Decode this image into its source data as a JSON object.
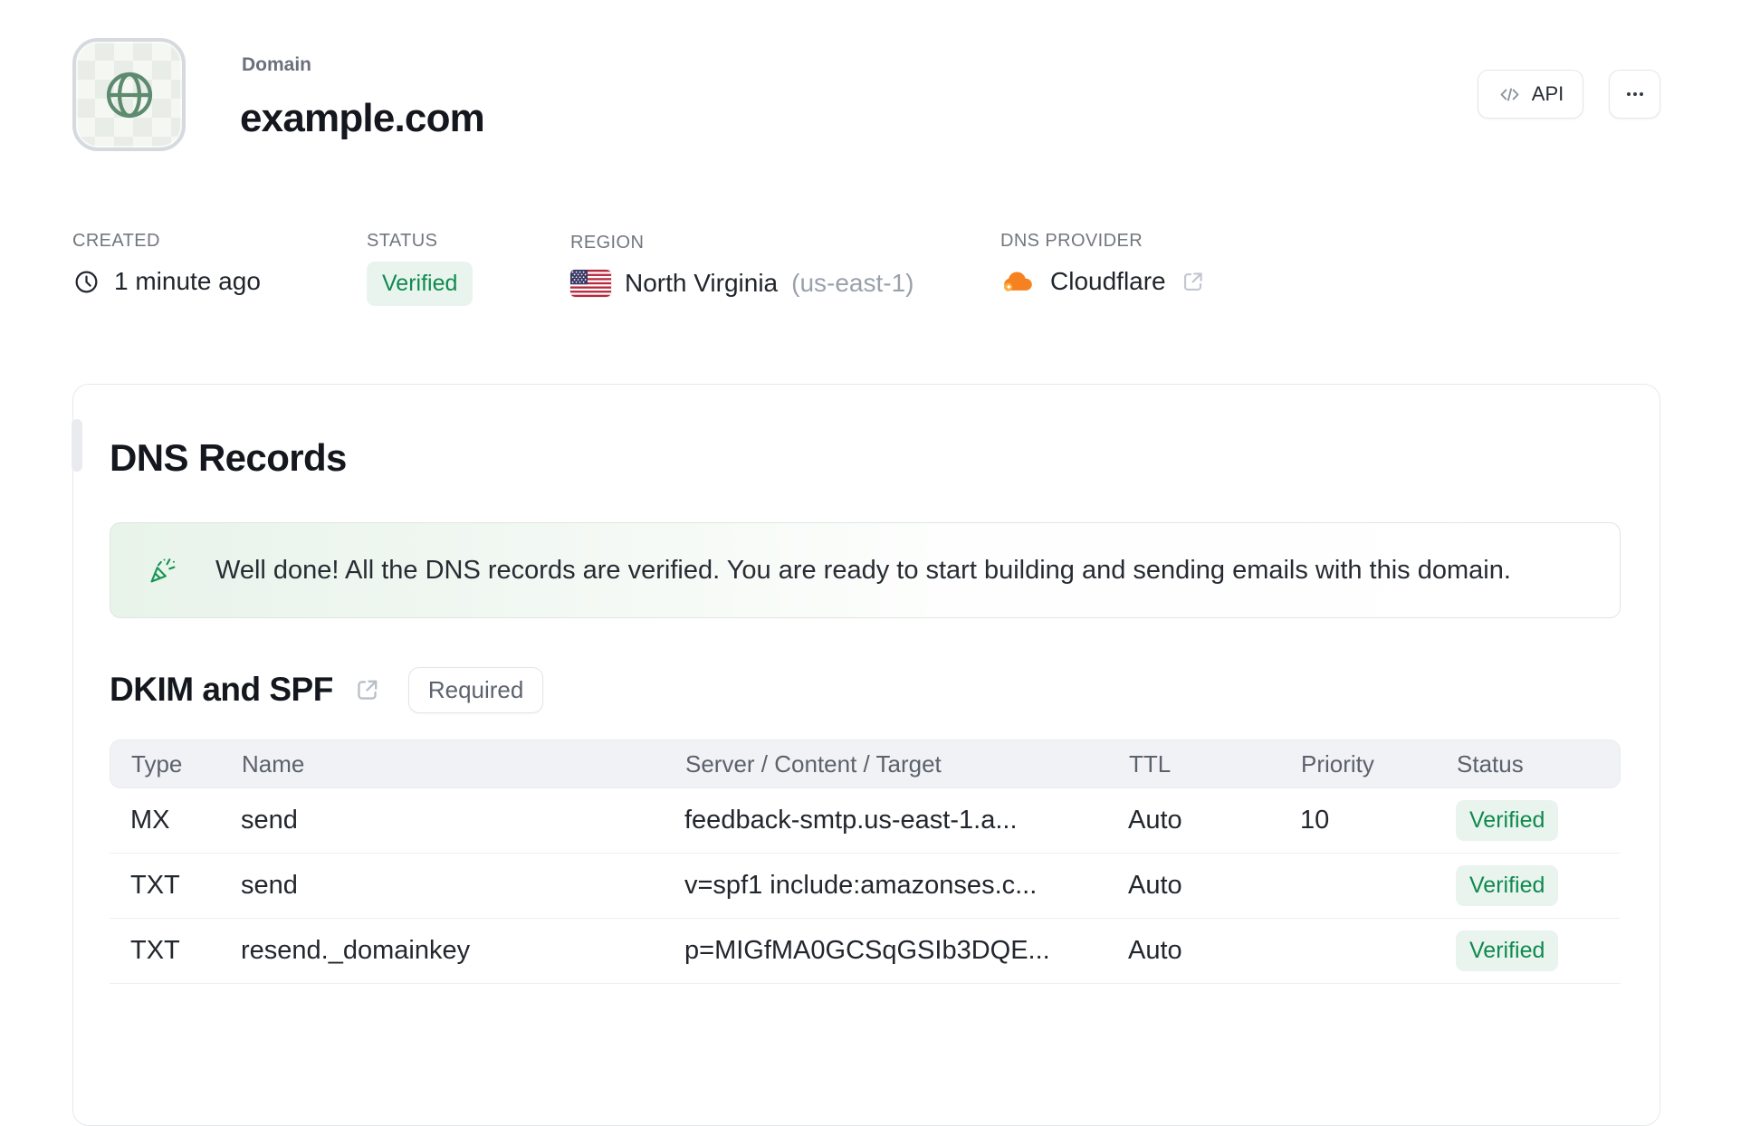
{
  "colors": {
    "accent_green": "#0f8a4e",
    "badge_green_bg": "#e9f4ee",
    "globe_green": "#5d8b6f",
    "cloudflare_orange": "#f6821f",
    "card_border": "#e5e8ec",
    "table_header_bg": "#f1f2f5"
  },
  "header": {
    "favicon_icon": "globe-icon",
    "label": "Domain",
    "title": "example.com",
    "api_button": {
      "icon": "code-icon",
      "label": "API"
    },
    "more_button": {
      "icon": "ellipsis-icon"
    }
  },
  "meta": {
    "created": {
      "label": "CREATED",
      "icon": "clock-icon",
      "value": "1 minute ago"
    },
    "status": {
      "label": "STATUS",
      "badge": "Verified"
    },
    "region": {
      "label": "REGION",
      "icon": "us-flag-icon",
      "name": "North Virginia",
      "code": "(us-east-1)"
    },
    "dns_provider": {
      "label": "DNS PROVIDER",
      "icon": "cloudflare-icon",
      "value": "Cloudflare",
      "link_icon": "external-link-icon"
    }
  },
  "dns_records": {
    "title": "DNS Records",
    "banner": {
      "icon": "party-popper-icon",
      "message": "Well done! All the DNS records are verified. You are ready to start building and sending emails with this domain."
    },
    "section": {
      "title": "DKIM and SPF",
      "link_icon": "external-link-icon",
      "badge": "Required"
    },
    "table": {
      "columns": [
        "Type",
        "Name",
        "Server / Content / Target",
        "TTL",
        "Priority",
        "Status"
      ],
      "rows": [
        {
          "type": "MX",
          "name": "send",
          "content": "feedback-smtp.us-east-1.a...",
          "ttl": "Auto",
          "priority": "10",
          "status": "Verified"
        },
        {
          "type": "TXT",
          "name": "send",
          "content": "v=spf1 include:amazonses.c...",
          "ttl": "Auto",
          "priority": "",
          "status": "Verified"
        },
        {
          "type": "TXT",
          "name": "resend._domainkey",
          "content": "p=MIGfMA0GCSqGSIb3DQE...",
          "ttl": "Auto",
          "priority": "",
          "status": "Verified"
        }
      ]
    }
  }
}
